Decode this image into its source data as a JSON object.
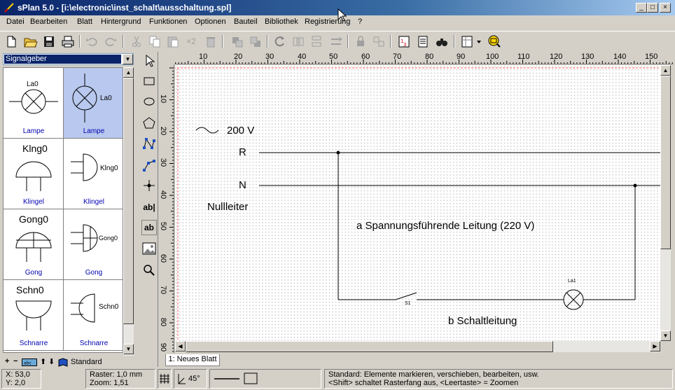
{
  "window": {
    "title": "sPlan 5.0 - [i:\\electronic\\inst_schalt\\ausschaltung.spl]",
    "controls": [
      "_",
      "□",
      "×"
    ]
  },
  "menu": [
    "Datei",
    "Bearbeiten",
    "Blatt",
    "Hintergrund",
    "Funktionen",
    "Optionen",
    "Bauteil",
    "Bibliothek",
    "Registrierung",
    "?"
  ],
  "toolbar": {
    "x2_label": "×2"
  },
  "library": {
    "selected": "Signalgeber",
    "cells": [
      {
        "symbol": "La0",
        "label": "Lampe"
      },
      {
        "symbol": "La0",
        "label": "Lampe"
      },
      {
        "symbol": "Klng0",
        "label": "Klingel"
      },
      {
        "symbol": "Klng0",
        "label": "Klingel"
      },
      {
        "symbol": "Gong0",
        "label": "Gong"
      },
      {
        "symbol": "Gong0",
        "label": "Gong"
      },
      {
        "symbol": "Schn0",
        "label": "Schnarre"
      },
      {
        "symbol": "Schn0",
        "label": "Schnarre"
      }
    ],
    "footer_label": "Standard"
  },
  "tools": {
    "text_tool_1": "ab|",
    "text_tool_2": "ab"
  },
  "ruler": {
    "top": [
      "10",
      "20",
      "30",
      "40",
      "50",
      "60",
      "70",
      "80",
      "90",
      "100",
      "110",
      "120",
      "130",
      "140",
      "150"
    ],
    "left": [
      "10",
      "20",
      "30",
      "40",
      "50",
      "60",
      "70",
      "80",
      "90"
    ]
  },
  "schematic": {
    "voltage": "200 V",
    "line_r": "R",
    "line_n": "N",
    "neutral": "Nullleiter",
    "label_a": "a Spannungsführende Leitung (220 V)",
    "label_b": "b Schaltleitung",
    "switch": "S1",
    "lamp": "La1"
  },
  "sheet_tab": "1: Neues Blatt",
  "status": {
    "x": "X: 53,0",
    "y": "Y: 2,0",
    "raster": "Raster: 1,0 mm",
    "zoom": "Zoom:   1,51",
    "angle": "45°",
    "hint1": "Standard: Elemente markieren, verschieben, bearbeiten, usw.",
    "hint2": "<Shift> schaltet Rasterfang aus, <Leertaste> = Zoomen"
  },
  "colors": {
    "titlebar": "#0a246a",
    "selection": "#b8c8ee",
    "library_label": "#0000b0"
  }
}
